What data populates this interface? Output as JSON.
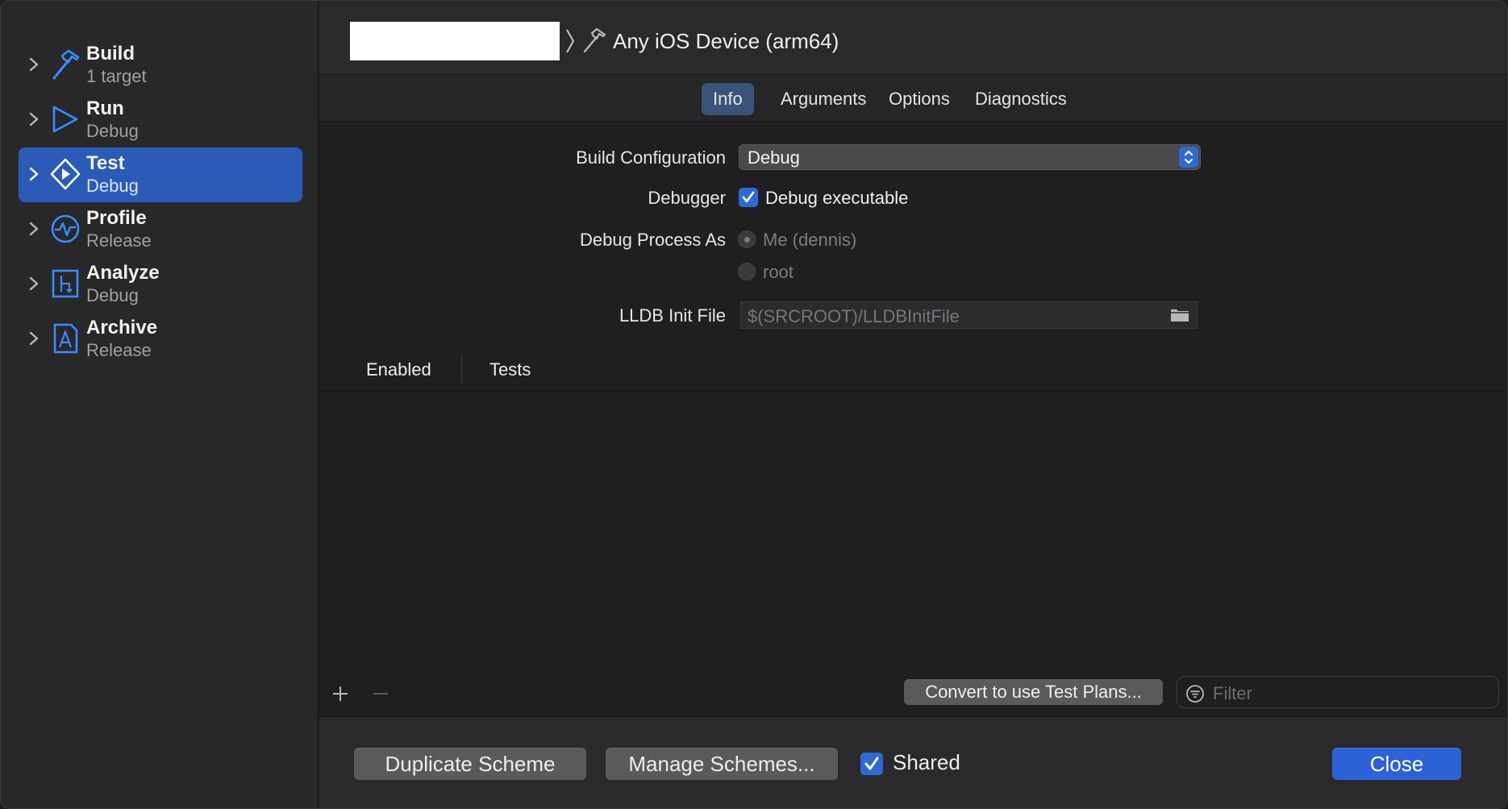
{
  "sidebar": {
    "items": [
      {
        "title": "Build",
        "subtitle": "1 target",
        "icon": "hammer-icon",
        "selected": false
      },
      {
        "title": "Run",
        "subtitle": "Debug",
        "icon": "play-icon",
        "selected": false
      },
      {
        "title": "Test",
        "subtitle": "Debug",
        "icon": "test-diamond-icon",
        "selected": true
      },
      {
        "title": "Profile",
        "subtitle": "Release",
        "icon": "waveform-icon",
        "selected": false
      },
      {
        "title": "Analyze",
        "subtitle": "Debug",
        "icon": "analyze-icon",
        "selected": false
      },
      {
        "title": "Archive",
        "subtitle": "Release",
        "icon": "archive-icon",
        "selected": false
      }
    ]
  },
  "toolbar": {
    "destination": "Any iOS Device (arm64)"
  },
  "tabs": [
    "Info",
    "Arguments",
    "Options",
    "Diagnostics"
  ],
  "active_tab": "Info",
  "info": {
    "build_configuration_label": "Build Configuration",
    "build_configuration_value": "Debug",
    "debugger_label": "Debugger",
    "debugger_checkbox_label": "Debug executable",
    "debugger_checked": true,
    "debug_process_label": "Debug Process As",
    "debug_process_options": [
      "Me (dennis)",
      "root"
    ],
    "lldb_label": "LLDB Init File",
    "lldb_value": "$(SRCROOT)/LLDBInitFile"
  },
  "table": {
    "headers": [
      "Enabled",
      "Tests"
    ]
  },
  "bottom_bar": {
    "convert_button": "Convert to use Test Plans...",
    "filter_placeholder": "Filter"
  },
  "footer": {
    "duplicate_button": "Duplicate Scheme",
    "manage_button": "Manage Schemes...",
    "shared_label": "Shared",
    "shared_checked": true,
    "close_button": "Close"
  },
  "colors": {
    "accent": "#2f6ad3",
    "selection": "#2c5bb7",
    "icon_blue": "#3d8bff",
    "window_bg": "#1f1f21"
  }
}
